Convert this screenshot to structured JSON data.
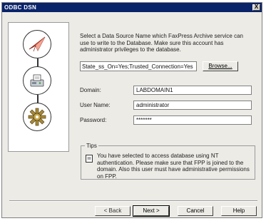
{
  "window": {
    "title": "ODBC DSN",
    "close_label": "X"
  },
  "description": "Select a Data Source Name which FaxPress Archive service can use to write to the Database. Make sure this account has administrator privileges to the database.",
  "connection_string": {
    "value": "State_ss_On=Yes;Trusted_Connection=Yes",
    "browse_label": "Browse..."
  },
  "fields": {
    "domain": {
      "label": "Domain:",
      "value": "LABDOMAIN1"
    },
    "user_name": {
      "label": "User Name:",
      "value": "administrator"
    },
    "password": {
      "label": "Password:",
      "value": "*******"
    }
  },
  "tips": {
    "legend": "Tips",
    "text": "You have selected to access database using NT authentication. Please make sure that FPP is joined to the domain. Also this user must have administrative permissions on FPP."
  },
  "buttons": {
    "back": "< Back",
    "next": "Next >",
    "cancel": "Cancel",
    "help": "Help"
  },
  "icons": [
    "paper-plane-icon",
    "fax-machine-icon",
    "gear-icon"
  ]
}
